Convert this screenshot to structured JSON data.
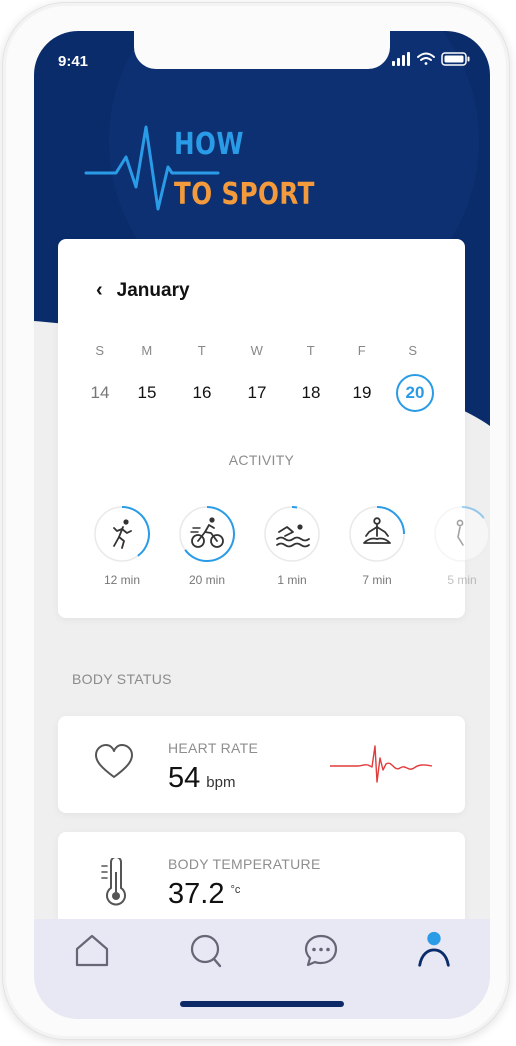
{
  "status_bar": {
    "time": "9:41"
  },
  "logo": {
    "line1": "HOW",
    "line2": "TO SPORT"
  },
  "calendar": {
    "month": "January",
    "days": [
      {
        "letter": "S",
        "date": "14",
        "state": "muted"
      },
      {
        "letter": "M",
        "date": "15",
        "state": "normal"
      },
      {
        "letter": "T",
        "date": "16",
        "state": "normal"
      },
      {
        "letter": "W",
        "date": "17",
        "state": "normal"
      },
      {
        "letter": "T",
        "date": "18",
        "state": "normal"
      },
      {
        "letter": "F",
        "date": "19",
        "state": "normal"
      },
      {
        "letter": "S",
        "date": "20",
        "state": "selected"
      }
    ]
  },
  "activity": {
    "title": "ACTIVITY",
    "items": [
      {
        "icon": "running-icon",
        "label": "12 min",
        "progress": 0.4
      },
      {
        "icon": "cycling-icon",
        "label": "20 min",
        "progress": 0.65
      },
      {
        "icon": "swimming-icon",
        "label": "1 min",
        "progress": 0.03
      },
      {
        "icon": "meditation-icon",
        "label": "7 min",
        "progress": 0.25
      },
      {
        "icon": "activity-icon",
        "label": "5 min",
        "progress": 0.15
      }
    ]
  },
  "body_status": {
    "title": "BODY STATUS",
    "heart": {
      "label": "HEART RATE",
      "value": "54",
      "unit": "bpm"
    },
    "temperature": {
      "label": "BODY TEMPERATURE",
      "value": "37.2",
      "unit": "°c"
    }
  },
  "colors": {
    "header_navy": "#0b2c6b",
    "accent_blue": "#2a9be6",
    "logo_orange": "#f39a3c",
    "heart_red": "#e23b3b",
    "tab_active": "#0b2c6b"
  },
  "tabbar": {
    "items": [
      {
        "icon": "home-icon",
        "active": false
      },
      {
        "icon": "search-icon",
        "active": false
      },
      {
        "icon": "chat-icon",
        "active": false
      },
      {
        "icon": "profile-icon",
        "active": true
      }
    ]
  }
}
